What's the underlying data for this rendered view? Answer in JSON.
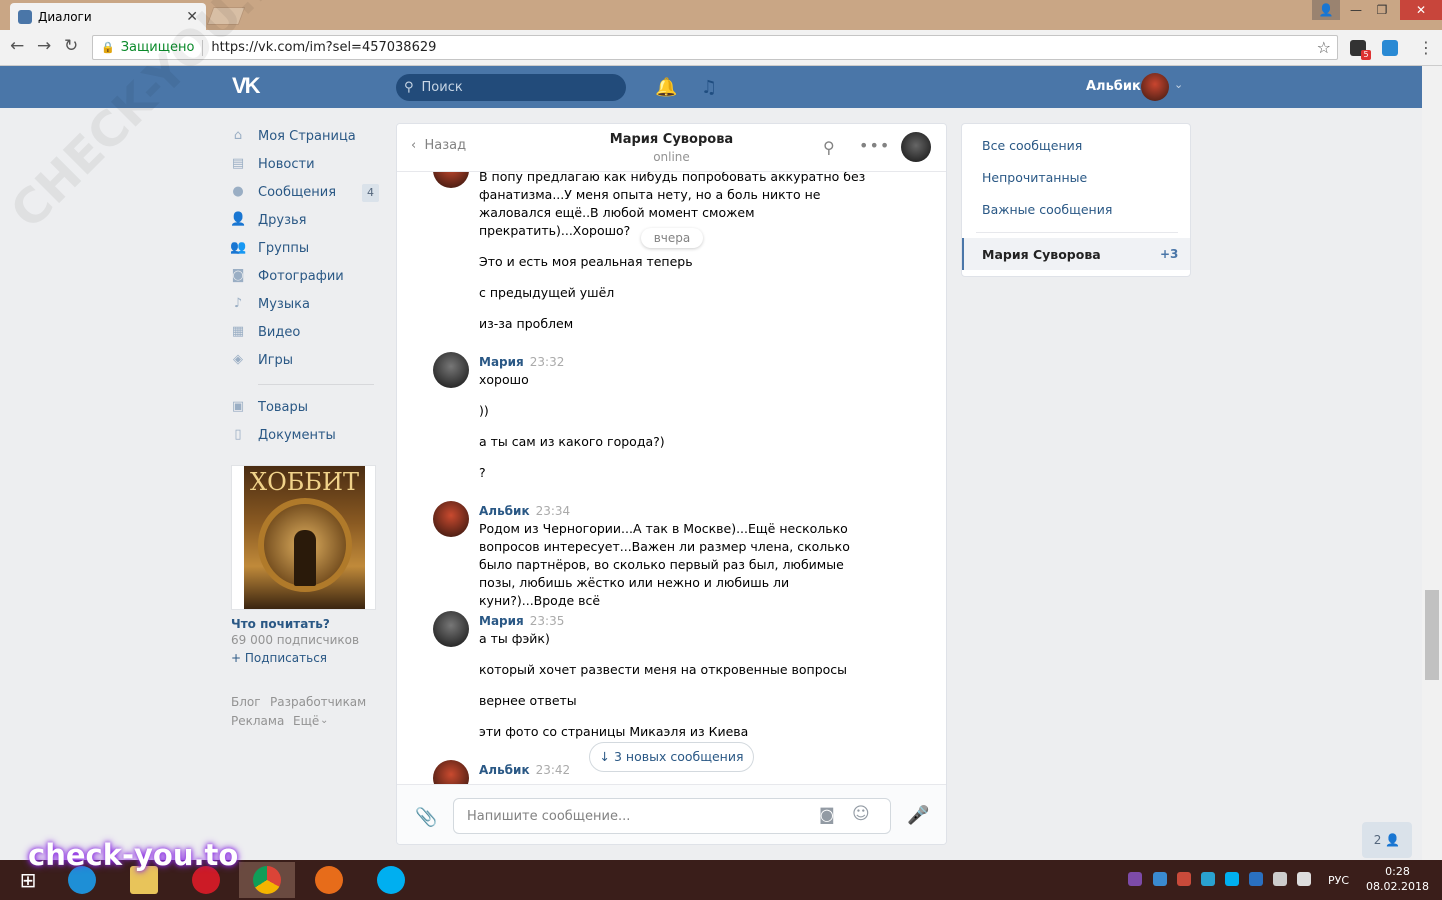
{
  "browser": {
    "tab_title": "Диалоги",
    "secure_label": "Защищено",
    "url": "https://vk.com/im?sel=457038629",
    "ext_badge": "5"
  },
  "header": {
    "search_placeholder": "Поиск",
    "user_name": "Альбик"
  },
  "menu": {
    "items": [
      {
        "label": "Моя Страница",
        "icon": "home-icon"
      },
      {
        "label": "Новости",
        "icon": "news-icon"
      },
      {
        "label": "Сообщения",
        "icon": "messages-icon",
        "badge": "4"
      },
      {
        "label": "Друзья",
        "icon": "friends-icon"
      },
      {
        "label": "Группы",
        "icon": "groups-icon"
      },
      {
        "label": "Фотографии",
        "icon": "photos-icon"
      },
      {
        "label": "Музыка",
        "icon": "music-icon"
      },
      {
        "label": "Видео",
        "icon": "video-icon"
      },
      {
        "label": "Игры",
        "icon": "games-icon"
      }
    ],
    "items2": [
      {
        "label": "Товары",
        "icon": "goods-icon"
      },
      {
        "label": "Документы",
        "icon": "docs-icon"
      }
    ]
  },
  "ad": {
    "image_title": "ХОББИТ",
    "name": "Что почитать?",
    "subscribers": "69 000 подписчиков",
    "subscribe": "+ Подписаться"
  },
  "footer": {
    "links": [
      "Блог",
      "Разработчикам",
      "Реклама",
      "Ещё"
    ]
  },
  "chat": {
    "back_label": "Назад",
    "contact_name": "Мария Суворова",
    "contact_status": "online",
    "date_pill": "вчера",
    "partial_lines": [
      "В попу предлагаю как нибудь попробовать аккуратно без",
      "фанатизма...У меня опыта нету, но а боль никто не",
      "жаловался ещё..В любой момент сможем",
      "прекратить)...Хорошо?"
    ],
    "partial_extra": [
      "Это и есть моя реальная теперь",
      "с предыдущей ушёл",
      "из-за проблем"
    ],
    "groups": [
      {
        "sender": "Мария",
        "time": "23:32",
        "lines": [
          "хорошо",
          "))",
          "а ты сам из какого города?)",
          "?"
        ]
      },
      {
        "sender": "Альбик",
        "time": "23:34",
        "lines": [
          "Родом из Черногории...А так в Москве)...Ещё несколько вопросов интересует...Важен ли размер члена, сколько было партнёров, во сколько первый раз был, любимые позы, любишь жёстко или нежно и любишь ли куни?)...Вроде всё"
        ]
      },
      {
        "sender": "Мария",
        "time": "23:35",
        "lines": [
          "а ты фэйк)",
          "который хочет развести меня на откровенные вопросы",
          "вернее ответы",
          "эти фото со страницы Микаэля из Киева"
        ]
      },
      {
        "sender": "Альбик",
        "time": "23:42",
        "lines": []
      }
    ],
    "new_messages": "3 новых сообщения",
    "composer_placeholder": "Напишите сообщение..."
  },
  "right_panel": {
    "items": [
      "Все сообщения",
      "Непрочитанные",
      "Важные сообщения"
    ],
    "active_name": "Мария Суворова",
    "active_count": "+3"
  },
  "friends_count": "2",
  "taskbar": {
    "lang": "РУС",
    "time": "0:28",
    "date": "08.02.2018"
  },
  "watermark": {
    "diagonal": "CHECK-YOU.ME",
    "bottom": "check-you.to"
  }
}
